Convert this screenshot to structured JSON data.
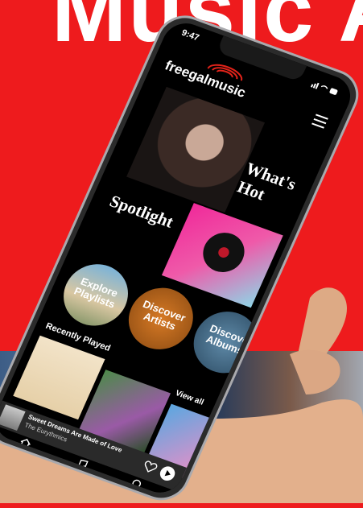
{
  "background": {
    "headline": "Music A"
  },
  "status_bar": {
    "time": "9:47"
  },
  "app": {
    "brand": "freegalmusic"
  },
  "hero": {
    "whats_hot": "What's Hot",
    "spotlight": "Spotlight"
  },
  "categories": [
    {
      "label": "Explore\nPlaylists"
    },
    {
      "label": "Discover\nArtists"
    },
    {
      "label": "Discove\nAlbums"
    }
  ],
  "recently_played": {
    "title": "Recently Played",
    "view_all": "View all"
  },
  "player": {
    "song": "Sweet Dreams Are Made of Love",
    "artist": "The Eurythmics"
  },
  "nav": [
    {
      "label": "Home"
    },
    {
      "label": "My Music"
    },
    {
      "label": "Search"
    }
  ]
}
